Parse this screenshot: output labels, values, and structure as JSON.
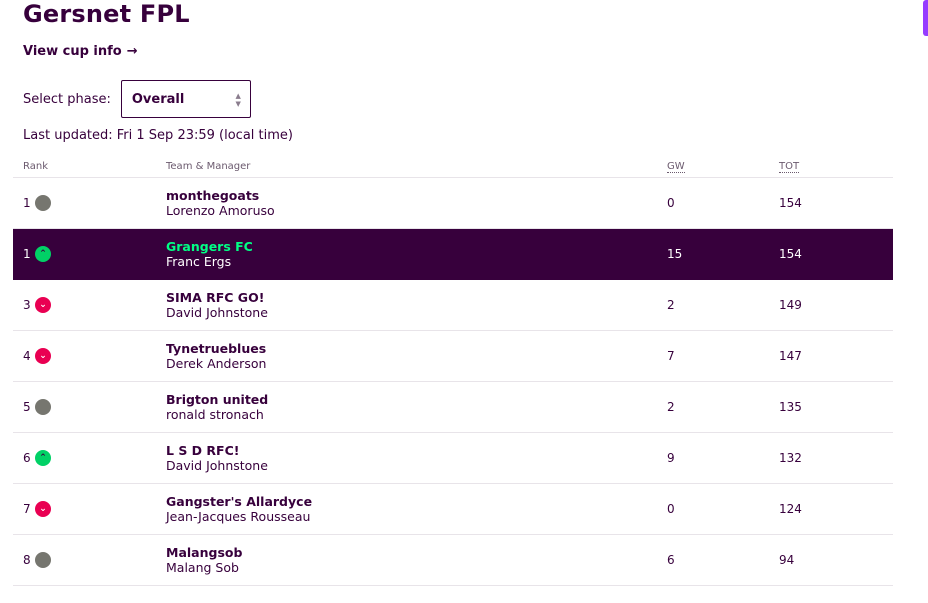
{
  "league": {
    "title": "Gersnet FPL",
    "cup_link_label": "View cup info",
    "cup_link_arrow": "→"
  },
  "phase": {
    "label": "Select phase:",
    "selected": "Overall"
  },
  "last_updated": "Last updated: Fri 1 Sep 23:59 (local time)",
  "table": {
    "headers": {
      "rank": "Rank",
      "team": "Team & Manager",
      "gw": "GW",
      "tot": "TOT"
    },
    "rows": [
      {
        "rank": "1",
        "movement": "same",
        "team": "monthegoats",
        "manager": "Lorenzo Amoruso",
        "gw": "0",
        "tot": "154",
        "highlight": false
      },
      {
        "rank": "1",
        "movement": "up",
        "team": "Grangers FC",
        "manager": "Franc Ergs",
        "gw": "15",
        "tot": "154",
        "highlight": true
      },
      {
        "rank": "3",
        "movement": "down",
        "team": "SIMA RFC GO!",
        "manager": "David Johnstone",
        "gw": "2",
        "tot": "149",
        "highlight": false
      },
      {
        "rank": "4",
        "movement": "down",
        "team": "Tynetrueblues",
        "manager": "Derek Anderson",
        "gw": "7",
        "tot": "147",
        "highlight": false
      },
      {
        "rank": "5",
        "movement": "same",
        "team": "Brigton united",
        "manager": "ronald stronach",
        "gw": "2",
        "tot": "135",
        "highlight": false
      },
      {
        "rank": "6",
        "movement": "up",
        "team": "L S D RFC!",
        "manager": "David Johnstone",
        "gw": "9",
        "tot": "132",
        "highlight": false
      },
      {
        "rank": "7",
        "movement": "down",
        "team": "Gangster's Allardyce",
        "manager": "Jean-Jacques Rousseau",
        "gw": "0",
        "tot": "124",
        "highlight": false
      },
      {
        "rank": "8",
        "movement": "same",
        "team": "Malangsob",
        "manager": "Malang Sob",
        "gw": "6",
        "tot": "94",
        "highlight": false
      }
    ]
  },
  "icons": {
    "same": "circle-icon",
    "up": "chevron-up-icon",
    "down": "chevron-down-icon"
  },
  "colors": {
    "brand_purple": "#37003c",
    "highlight_green": "#00ff85",
    "up": "#01d166",
    "down": "#e90052",
    "same": "#76766f"
  }
}
